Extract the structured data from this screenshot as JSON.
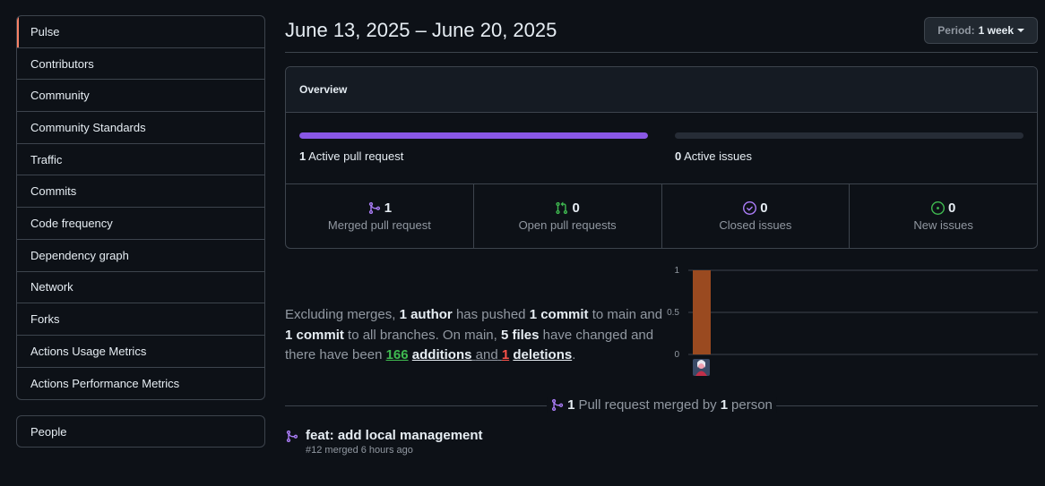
{
  "sidebar": {
    "items": [
      {
        "label": "Pulse"
      },
      {
        "label": "Contributors"
      },
      {
        "label": "Community"
      },
      {
        "label": "Community Standards"
      },
      {
        "label": "Traffic"
      },
      {
        "label": "Commits"
      },
      {
        "label": "Code frequency"
      },
      {
        "label": "Dependency graph"
      },
      {
        "label": "Network"
      },
      {
        "label": "Forks"
      },
      {
        "label": "Actions Usage Metrics"
      },
      {
        "label": "Actions Performance Metrics"
      }
    ],
    "people_label": "People"
  },
  "header": {
    "date_range": "June 13, 2025 – June 20, 2025",
    "period_label": "Period:",
    "period_value": "1 week"
  },
  "overview": {
    "title": "Overview",
    "pull_requests": {
      "count": "1",
      "label": "Active pull request",
      "fill_fraction": 1.0
    },
    "issues": {
      "count": "0",
      "label": "Active issues",
      "fill_fraction": 0
    },
    "stats": [
      {
        "count": "1",
        "label": "Merged pull request",
        "icon": "merge-icon",
        "color": "#ab7df8"
      },
      {
        "count": "0",
        "label": "Open pull requests",
        "icon": "pull-request-icon",
        "color": "#3fb950"
      },
      {
        "count": "0",
        "label": "Closed issues",
        "icon": "issue-closed-icon",
        "color": "#ab7df8"
      },
      {
        "count": "0",
        "label": "New issues",
        "icon": "issue-opened-icon",
        "color": "#3fb950"
      }
    ]
  },
  "summary": {
    "p1": "Excluding merges,",
    "authors": "1 author",
    "p2": "has pushed",
    "commits_main": "1 commit",
    "p3": "to main and",
    "commits_all_num": "1",
    "commits_all_word": "commit",
    "p4": "to all branches. On main,",
    "files": "5 files",
    "p5": "have changed and there have been",
    "additions_num": "166",
    "additions_word": "additions",
    "p6": "and",
    "deletions_num": "1",
    "deletions_word": "deletions",
    "p7": "."
  },
  "chart_data": {
    "type": "bar",
    "categories": [
      "contributor"
    ],
    "values": [
      1
    ],
    "ylim": [
      0,
      1
    ],
    "yticks": [
      "1",
      "0.5",
      "0"
    ],
    "bar_color": "#9a4a20"
  },
  "merged": {
    "count": "1",
    "text1": "Pull request merged by",
    "people": "1",
    "text2": "person"
  },
  "pr": {
    "title": "feat: add local management",
    "meta": "#12 merged 6 hours ago"
  },
  "colors": {
    "accent_purple": "#8957e5",
    "selected_border": "#f78166"
  }
}
